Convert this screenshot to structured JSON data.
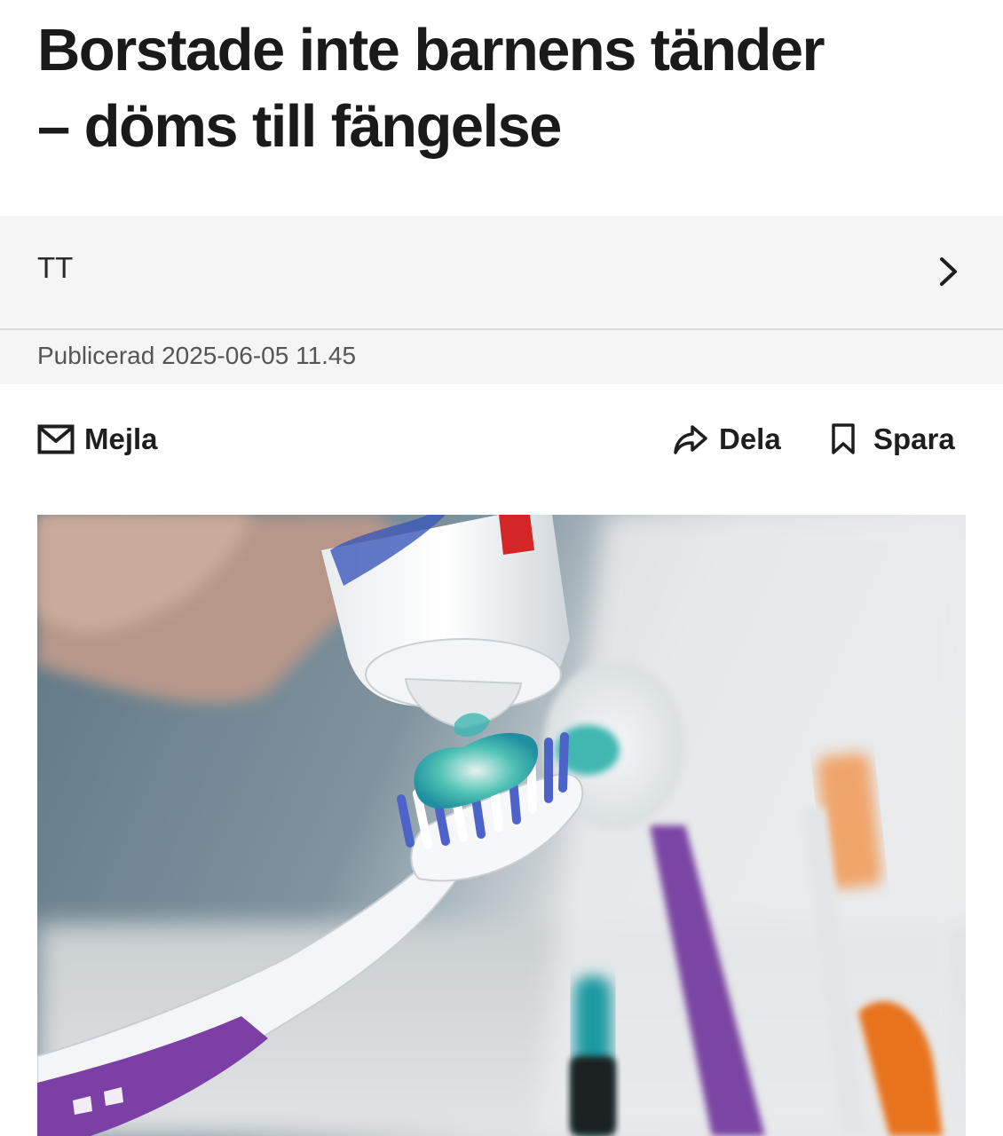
{
  "article": {
    "headline_line1": "Borstade inte barnens tänder",
    "headline_line2": "– döms till fängelse"
  },
  "author": {
    "name": "TT"
  },
  "published": {
    "text": "Publicerad 2025-06-05 11.45"
  },
  "actions": {
    "email_label": "Mejla",
    "share_label": "Dela",
    "save_label": "Spara"
  },
  "icons": {
    "email": "mail-icon",
    "share": "share-arrow-icon",
    "save": "bookmark-icon",
    "author_link": "chevron-right-icon"
  },
  "colors": {
    "text": "#1c1c1c",
    "panel_background": "#f5f5f5",
    "muted_text": "#555555"
  }
}
